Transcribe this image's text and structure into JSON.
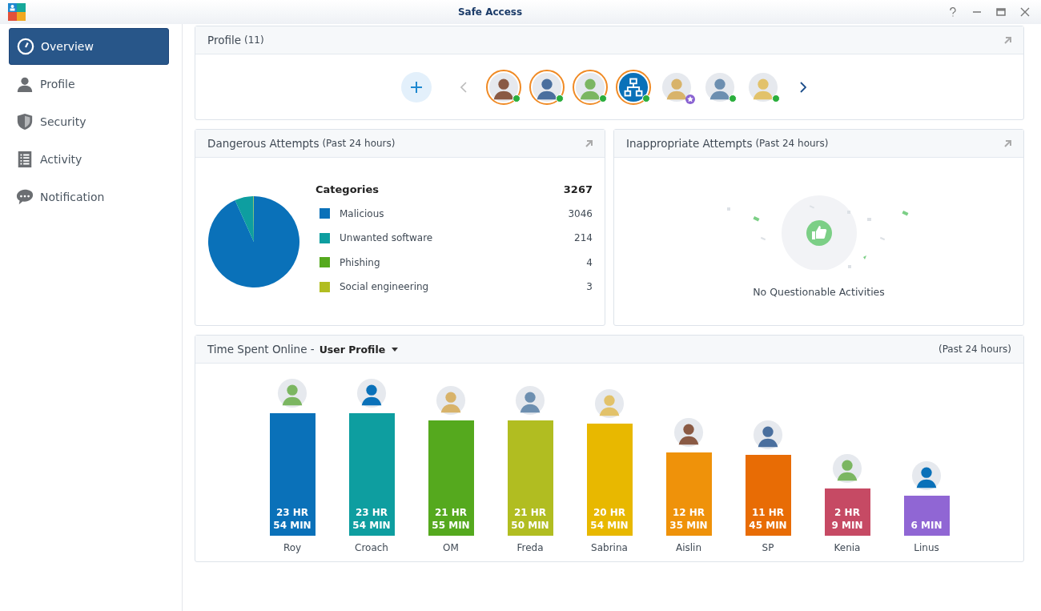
{
  "window": {
    "title": "Safe Access"
  },
  "sidebar": {
    "items": [
      {
        "label": "Overview",
        "selected": true
      },
      {
        "label": "Profile",
        "selected": false
      },
      {
        "label": "Security",
        "selected": false
      },
      {
        "label": "Activity",
        "selected": false
      },
      {
        "label": "Notification",
        "selected": false
      }
    ]
  },
  "profile_card": {
    "title": "Profile",
    "count": "(11)",
    "avatars": [
      {
        "kind": "photo",
        "ringed": true,
        "online": true,
        "starred": false
      },
      {
        "kind": "photo",
        "ringed": true,
        "online": true,
        "starred": false
      },
      {
        "kind": "photo",
        "ringed": true,
        "online": true,
        "starred": false
      },
      {
        "kind": "network",
        "ringed": true,
        "online": true,
        "starred": false
      },
      {
        "kind": "photo",
        "ringed": false,
        "online": false,
        "starred": true
      },
      {
        "kind": "photo",
        "ringed": false,
        "online": true,
        "starred": false
      },
      {
        "kind": "photo",
        "ringed": false,
        "online": true,
        "starred": false
      }
    ]
  },
  "dangerous_card": {
    "title": "Dangerous Attempts",
    "period": "(Past 24 hours)",
    "legend_title": "Categories",
    "total": "3267",
    "legend": [
      {
        "label": "Malicious",
        "count": "3046",
        "color": "#0a71b9"
      },
      {
        "label": "Unwanted software",
        "count": "214",
        "color": "#0e9ea0"
      },
      {
        "label": "Phishing",
        "count": "4",
        "color": "#55a91e"
      },
      {
        "label": "Social engineering",
        "count": "3",
        "color": "#b1bd21"
      }
    ]
  },
  "inappropriate_card": {
    "title": "Inappropriate Attempts",
    "period": "(Past 24 hours)",
    "message": "No Questionable Activities"
  },
  "time_card": {
    "title": "Time Spent Online -",
    "selector": "User Profile",
    "period": "(Past 24 hours)",
    "bars": [
      {
        "name": "Roy",
        "hours": "23 HR",
        "minutes": "54 MIN",
        "color": "#0a71b9"
      },
      {
        "name": "Croach",
        "hours": "23 HR",
        "minutes": "54 MIN",
        "color": "#0e9ea0"
      },
      {
        "name": "OM",
        "hours": "21 HR",
        "minutes": "55 MIN",
        "color": "#55a91e"
      },
      {
        "name": "Freda",
        "hours": "21 HR",
        "minutes": "50 MIN",
        "color": "#b1bd21"
      },
      {
        "name": "Sabrina",
        "hours": "20 HR",
        "minutes": "54 MIN",
        "color": "#e8b800"
      },
      {
        "name": "Aislin",
        "hours": "12 HR",
        "minutes": "35 MIN",
        "color": "#ef920a"
      },
      {
        "name": "SP",
        "hours": "11 HR",
        "minutes": "45 MIN",
        "color": "#e86c05"
      },
      {
        "name": "Kenia",
        "hours": "2 HR",
        "minutes": "9 MIN",
        "color": "#c64a64"
      },
      {
        "name": "Linus",
        "minutes": "6 MIN",
        "color": "#9066d4"
      }
    ]
  }
}
